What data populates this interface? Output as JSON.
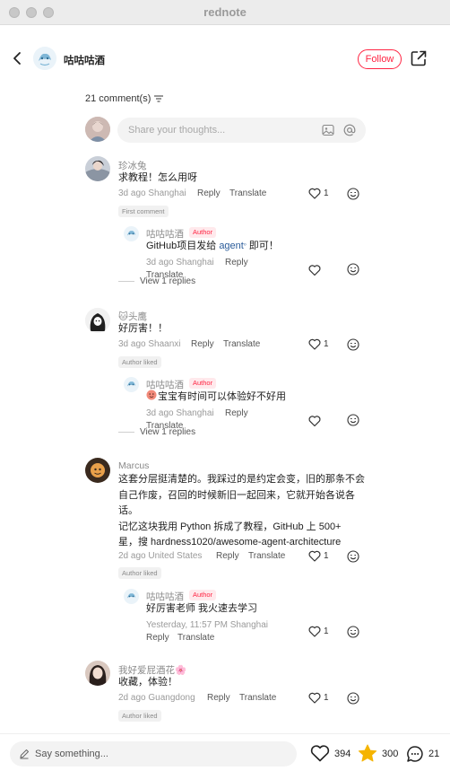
{
  "window": {
    "title": "rednote"
  },
  "header": {
    "author_name": "咕咕咕酒",
    "follow_label": "Follow"
  },
  "comments_header": {
    "count_label": "21 comment(s)"
  },
  "composer": {
    "placeholder": "Share your thoughts..."
  },
  "comments": [
    {
      "user": "珍冰兔",
      "text": "求教程！怎么用呀",
      "time": "3d ago",
      "location": "Shanghai",
      "reply_label": "Reply",
      "translate_label": "Translate",
      "likes": "1",
      "badge": "First comment",
      "reply": {
        "user": "咕咕咕酒",
        "author_tag": "Author",
        "text_prefix": "GitHub项目发给",
        "link_text": "agent",
        "text_suffix": "即可！",
        "time": "3d ago",
        "location": "Shanghai",
        "reply_label": "Reply",
        "translate_label": "Translate"
      },
      "view_replies": "View 1 replies"
    },
    {
      "user": "头鹰",
      "user_emoji": "🐱",
      "text": "好厉害！！",
      "time": "3d ago",
      "location": "Shaanxi",
      "reply_label": "Reply",
      "translate_label": "Translate",
      "likes": "1",
      "badge": "Author liked",
      "reply": {
        "user": "咕咕咕酒",
        "author_tag": "Author",
        "text": "宝宝有时间可以体验好不好用",
        "time": "3d ago",
        "location": "Shanghai",
        "reply_label": "Reply",
        "translate_label": "Translate"
      },
      "view_replies": "View 1 replies"
    },
    {
      "user": "Marcus",
      "text_lines": [
        "这套分层挺清楚的。我踩过的是约定会变，旧的那条不会",
        "自己作废，召回的时候新旧一起回来，它就开始各说各",
        "话。",
        "记忆这块我用 Python 拆成了教程，GitHub 上 500+",
        "星，搜 hardness1020/awesome-agent-architecture"
      ],
      "time": "2d ago",
      "location": "United States",
      "reply_label": "Reply",
      "translate_label": "Translate",
      "likes": "1",
      "badge": "Author liked",
      "reply": {
        "user": "咕咕咕酒",
        "author_tag": "Author",
        "text": "好厉害老师 我火速去学习",
        "time": "Yesterday, 11:57 PM",
        "location": "Shanghai",
        "reply_label": "Reply",
        "translate_label": "Translate",
        "likes": "1"
      }
    },
    {
      "user": "我好爱屁酒花",
      "user_emoji": "🌸",
      "text": "收藏，体验！",
      "time": "2d ago",
      "location": "Guangdong",
      "reply_label": "Reply",
      "translate_label": "Translate",
      "likes": "1",
      "badge": "Author liked"
    }
  ],
  "bottom_bar": {
    "say_placeholder": "Say something...",
    "likes": "394",
    "favorites": "300",
    "comments": "21"
  },
  "colors": {
    "accent": "#ff2442",
    "link": "#2b5c9a",
    "star": "#f5b400"
  }
}
